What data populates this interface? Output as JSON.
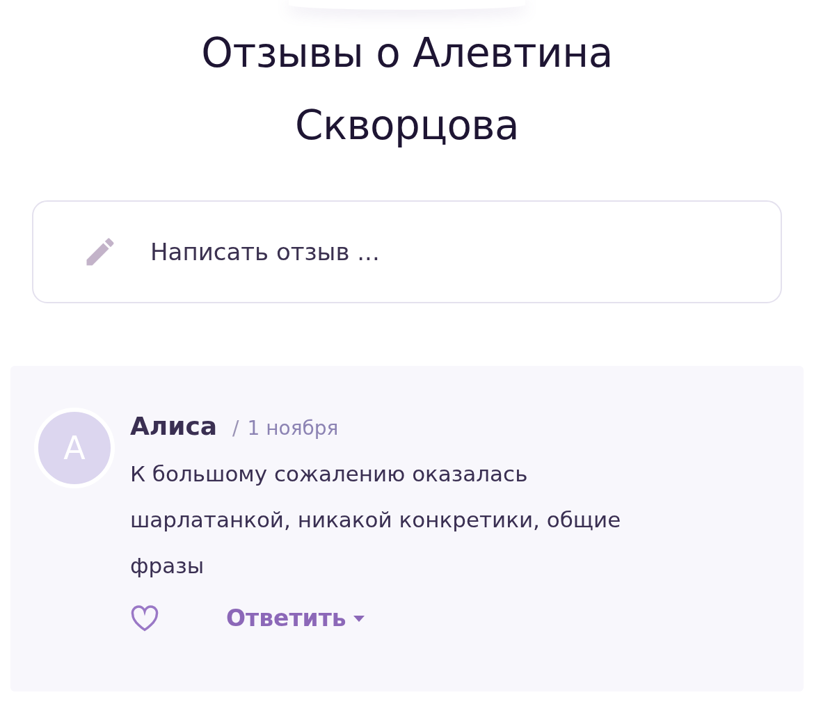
{
  "title": "Отзывы о Алевтина Скворцова",
  "review_field": {
    "placeholder": "Написать отзыв ..."
  },
  "reviews": [
    {
      "avatar_letter": "А",
      "author": "Алиса",
      "separator": "/",
      "date": "1 ноября",
      "text": "К большому сожалению оказалась шарлатанкой, никакой конкретики, общие фразы",
      "reply_label": "Ответить"
    }
  ]
}
